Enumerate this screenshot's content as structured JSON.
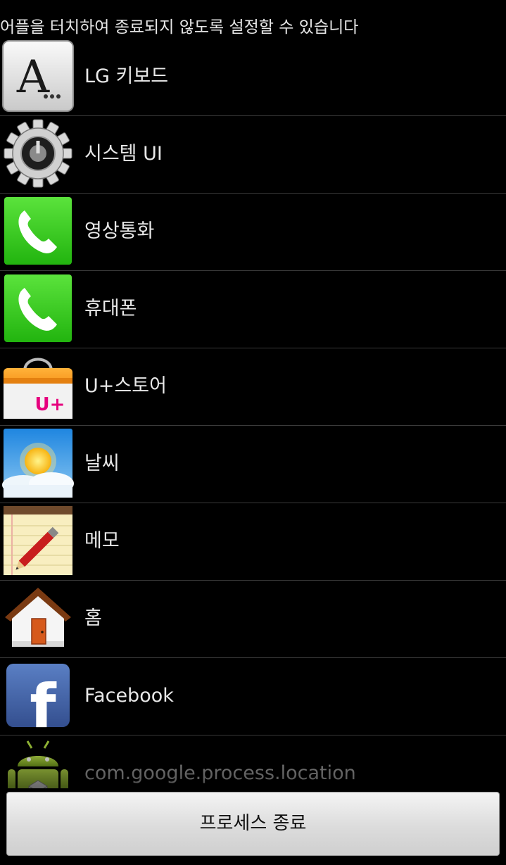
{
  "header": {
    "instruction": "어플을 터치하여 종료되지 않도록 설정할 수 있습니다"
  },
  "apps": [
    {
      "label": "LG 키보드",
      "icon": "keyboard-a-icon"
    },
    {
      "label": "시스템 UI",
      "icon": "gear-icon"
    },
    {
      "label": "영상통화",
      "icon": "phone-icon"
    },
    {
      "label": "휴대폰",
      "icon": "phone-icon"
    },
    {
      "label": "U+스토어",
      "icon": "shopping-bag-icon",
      "icon_text": "U+"
    },
    {
      "label": "날씨",
      "icon": "weather-sun-icon"
    },
    {
      "label": "메모",
      "icon": "memo-pencil-icon"
    },
    {
      "label": "홈",
      "icon": "house-icon"
    },
    {
      "label": "Facebook",
      "icon": "facebook-icon",
      "icon_text": "f"
    },
    {
      "label": "com.google.process.location",
      "icon": "android-icon"
    }
  ],
  "footer": {
    "kill_button_label": "프로세스 종료"
  },
  "colors": {
    "background": "#000000",
    "divider": "#3a3a3a",
    "phone_green": "#33cc1a",
    "facebook_blue": "#3b5998",
    "ustore_pink": "#e6007e",
    "android_green": "#9fc63a"
  }
}
